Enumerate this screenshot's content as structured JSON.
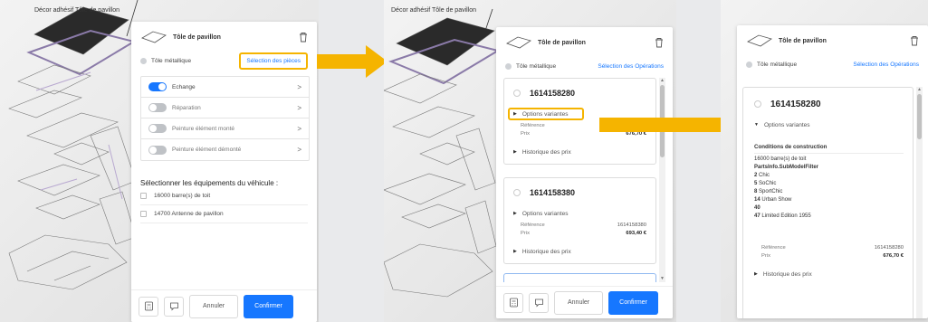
{
  "canvas_title": "Décor adhésif Tôle de pavillon",
  "panel_title": "Tôle de pavillon",
  "mode_label": "Tôle métallique",
  "step1": {
    "link": "Sélection des pièces",
    "toggles": [
      {
        "label": "Echange",
        "on": true
      },
      {
        "label": "Réparation",
        "on": false
      },
      {
        "label": "Peinture élément monté",
        "on": false
      },
      {
        "label": "Peinture élément démonté",
        "on": false
      }
    ],
    "equipment_title": "Sélectionner les équipements du véhicule :",
    "equipment": [
      "16000 barre(s) de toit",
      "14700 Antenne de pavillon"
    ],
    "cancel": "Annuler",
    "confirm": "Confirmer"
  },
  "step2": {
    "link": "Sélection des Opérations",
    "variants_label": "Options variantes",
    "ref_label": "Référence",
    "price_label": "Prix",
    "history_label": "Historique des prix",
    "cards": [
      {
        "part": "1614158280",
        "ref": "1614158280",
        "price": "676,70 €"
      },
      {
        "part": "1614158380",
        "ref": "1614158380",
        "price": "693,40 €"
      }
    ],
    "cancel": "Annuler",
    "confirm": "Confirmer"
  },
  "step3": {
    "link": "Sélection des Opérations",
    "part": "1614158280",
    "variants_label": "Options variantes",
    "conditions_title": "Conditions de construction",
    "roof_bars": "16000 barre(s) de toit",
    "filter_title": "PartsInfo.SubModelFilter",
    "submodels": [
      {
        "code": "2",
        "name": "Chic"
      },
      {
        "code": "5",
        "name": "SoChic"
      },
      {
        "code": "8",
        "name": "SportChic"
      },
      {
        "code": "14",
        "name": "Urban Show"
      },
      {
        "code": "40",
        "name": ""
      },
      {
        "code": "47",
        "name": "Limited Edition 1955"
      }
    ],
    "ref_label": "Référence",
    "ref": "1614158280",
    "price_label": "Prix",
    "price": "676,70 €",
    "history_label": "Historique des prix"
  },
  "colors": {
    "accent": "#1677ff",
    "highlight": "#f5b400"
  }
}
